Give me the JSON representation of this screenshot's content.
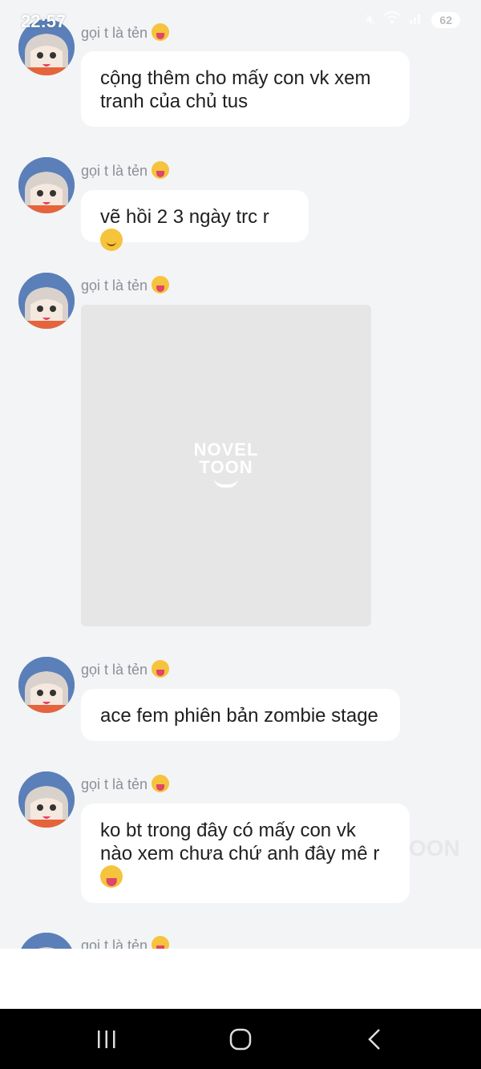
{
  "status_bar": {
    "time": "22:57",
    "battery": "62"
  },
  "messages": [
    {
      "sender": "gọi t là tẻn",
      "text": "cộng thêm cho mấy con vk xem tranh của chủ tus"
    },
    {
      "sender": "gọi t là tẻn",
      "text": "vẽ hồi 2 3 ngày trc r"
    },
    {
      "sender": "gọi t là tẻn",
      "image_watermark_line1": "NOVEL",
      "image_watermark_line2": "TOON"
    },
    {
      "sender": "gọi t là tẻn",
      "text": "ace fem phiên bản zombie stage"
    },
    {
      "sender": "gọi t là tẻn",
      "text": "ko bt trong đây có mấy con vk nào xem chưa chứ anh đây mê r"
    },
    {
      "sender": "gọi t là tẻn"
    }
  ],
  "background_watermark": "OON",
  "colors": {
    "background": "#f3f4f6",
    "bubble": "#ffffff",
    "sender_text": "#8b8f97",
    "image_placeholder": "#e6e6e6",
    "nav_bar": "#000000"
  },
  "icons": [
    "mute-icon",
    "wifi-icon",
    "signal-icon",
    "battery-icon",
    "recents-icon",
    "home-icon",
    "back-icon"
  ]
}
